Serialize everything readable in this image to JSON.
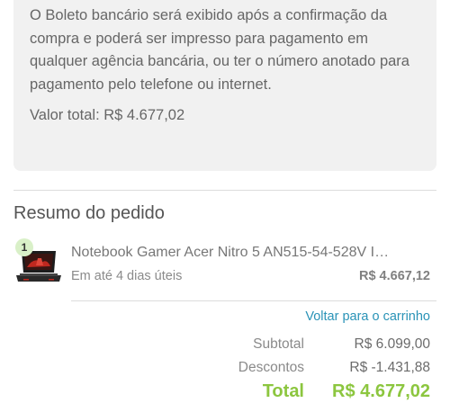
{
  "payment_info": {
    "description": "O Boleto bancário será exibido após a confirmação da compra e poderá ser impresso para pagamento em qualquer agência bancária, ou ter o número anotado para pagamento pelo telefone ou internet.",
    "total_label": "Valor total: R$ 4.677,02"
  },
  "summary": {
    "title": "Resumo do pedido",
    "items": [
      {
        "quantity": "1",
        "name": "Notebook Gamer Acer Nitro 5 AN515-54-528V Intel...",
        "delivery": "Em até 4 dias úteis",
        "price": "R$ 4.667,12",
        "image_icon": "laptop-icon"
      }
    ],
    "back_link": "Voltar para o carrinho",
    "subtotal_label": "Subtotal",
    "subtotal_value": "R$ 6.099,00",
    "discount_label": "Descontos",
    "discount_value": "R$ -1.431,88",
    "total_label": "Total",
    "total_value": "R$ 4.677,02"
  },
  "colors": {
    "accent_green": "#8cc63f",
    "link_blue": "#2a93b7",
    "panel_gray": "#f1f1f1"
  }
}
